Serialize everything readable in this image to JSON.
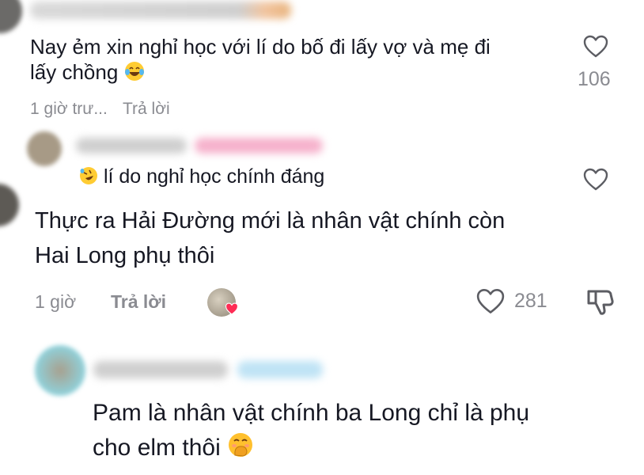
{
  "comments": [
    {
      "text_line1": "Nay ẻm xin nghỉ học với lí do bố đi lấy vợ và mẹ đi",
      "text_line2": "lấy chồng",
      "emoji": "laughing-tears",
      "like_count": "106",
      "time": "1 giờ trư...",
      "reply_label": "Trả lời"
    },
    {
      "text": "lí do nghỉ học chính đáng",
      "emoji": "rolling-laughing"
    },
    {
      "text_line1": "Thực ra Hải Đường mới là nhân vật chính còn",
      "text_line2": "Hai Long phụ thôi",
      "time": "1 giờ",
      "reply_label": "Trả lời",
      "like_count": "281"
    },
    {
      "text_line1": "Pam là nhân vật chính ba Long chỉ là phụ",
      "text_line2": "cho elm thôi",
      "emoji": "hand-over-mouth"
    }
  ],
  "colors": {
    "text": "#161823",
    "meta": "#8a8b91",
    "icon_stroke": "#5c5d63",
    "heart_badge": "#fe2c55",
    "username_blur_pink": "#f6b2cc",
    "username_blur_blue": "#bfe3f5"
  }
}
